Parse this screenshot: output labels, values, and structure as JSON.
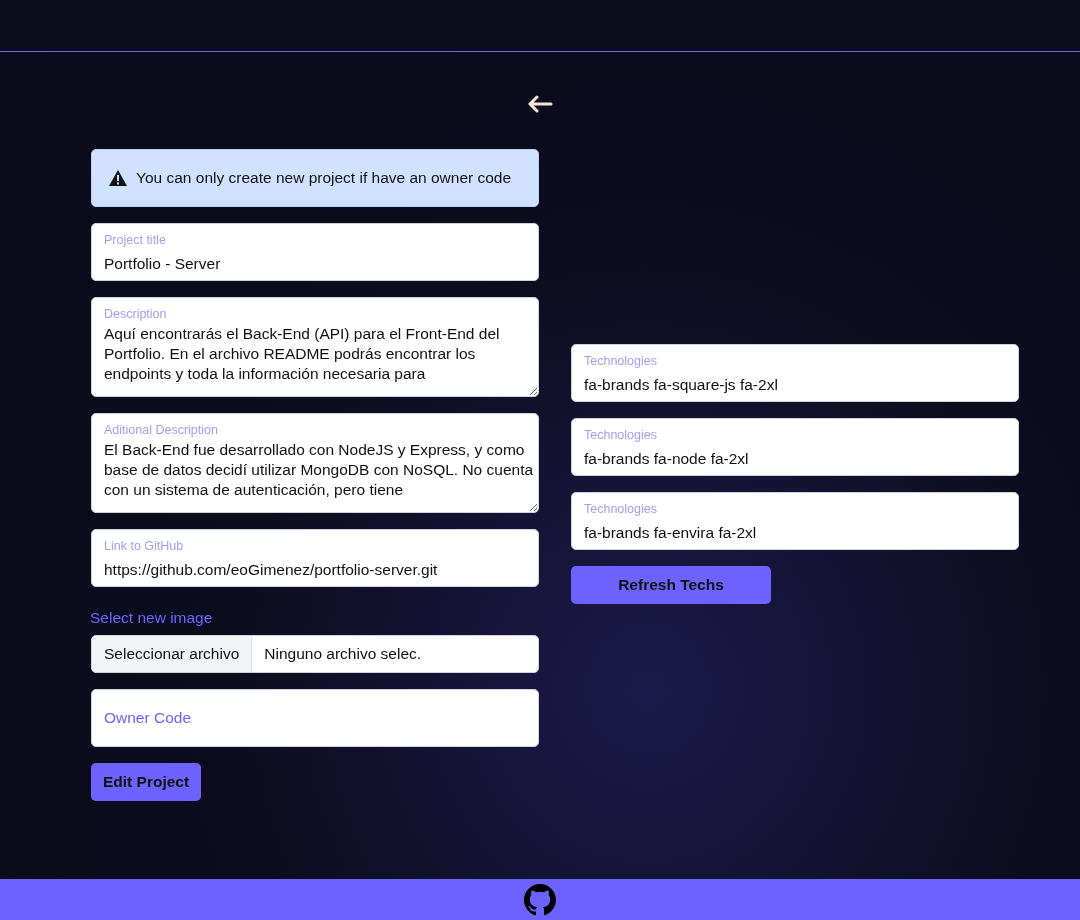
{
  "alert": {
    "text": "You can only create new project if have an owner code"
  },
  "fields": [
    {
      "kind": "input",
      "label": "Project title",
      "value": "Portfolio - Server"
    },
    {
      "kind": "textarea",
      "label": "Description",
      "value": "Aquí encontrarás el Back-End (API) para el Front-End del Portfolio. En el archivo README podrás encontrar los endpoints y toda la información necesaria para"
    },
    {
      "kind": "textarea",
      "label": "Aditional Description",
      "value": "El Back-End fue desarrollado con NodeJS y Express, y como base de datos decidí utilizar MongoDB con NoSQL. No cuenta con un sistema de autenticación, pero tiene"
    },
    {
      "kind": "input",
      "label": "Link to GitHub",
      "value": "https://github.com/eoGimenez/portfolio-server.git"
    }
  ],
  "image_label": "Select new image",
  "file_input": {
    "button": "Seleccionar archivo",
    "status": "Ninguno archivo selec."
  },
  "owner_code": {
    "placeholder": "Owner Code"
  },
  "submit_button": "Edit Project",
  "technologies": [
    {
      "label": "Technologies",
      "value": "fa-brands fa-square-js fa-2xl"
    },
    {
      "label": "Technologies",
      "value": "fa-brands fa-node fa-2xl"
    },
    {
      "label": "Technologies",
      "value": "fa-brands fa-envira fa-2xl"
    }
  ],
  "refresh_button": "Refresh Techs"
}
